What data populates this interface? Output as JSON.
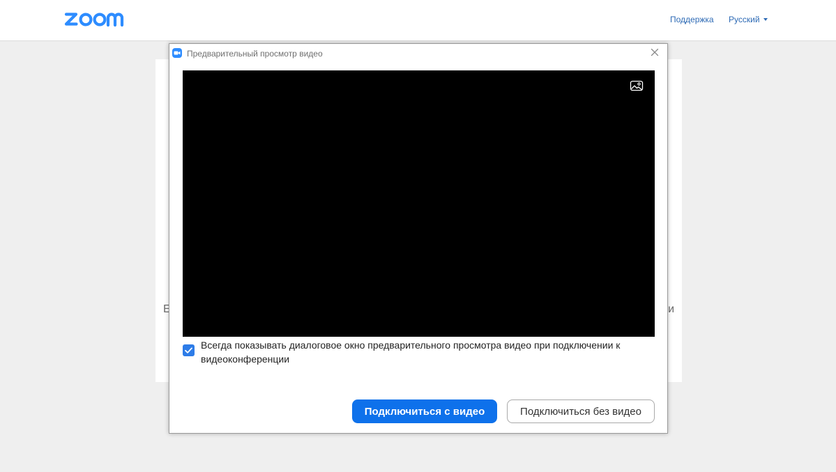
{
  "header": {
    "logo_text": "zoom",
    "support_link": "Поддержка",
    "language_selector": "Русский"
  },
  "background_card": {
    "partial_text_left": "E",
    "partial_text_right": "и"
  },
  "dialog": {
    "title": "Предварительный просмотр видео",
    "video_preview": {
      "background_toggle_icon": "image-background-icon"
    },
    "always_show_checkbox": {
      "checked": true,
      "label": "Всегда показывать диалоговое окно предварительного просмотра видео при подключении к видеоконференции"
    },
    "join_with_video_button": "Подключиться с видео",
    "join_without_video_button": "Подключиться без видео",
    "close_icon": "close-icon"
  },
  "colors": {
    "brand_blue": "#2d8cff",
    "primary_button": "#0e71eb",
    "link": "#2d6ab5",
    "page_background": "#efefef"
  }
}
